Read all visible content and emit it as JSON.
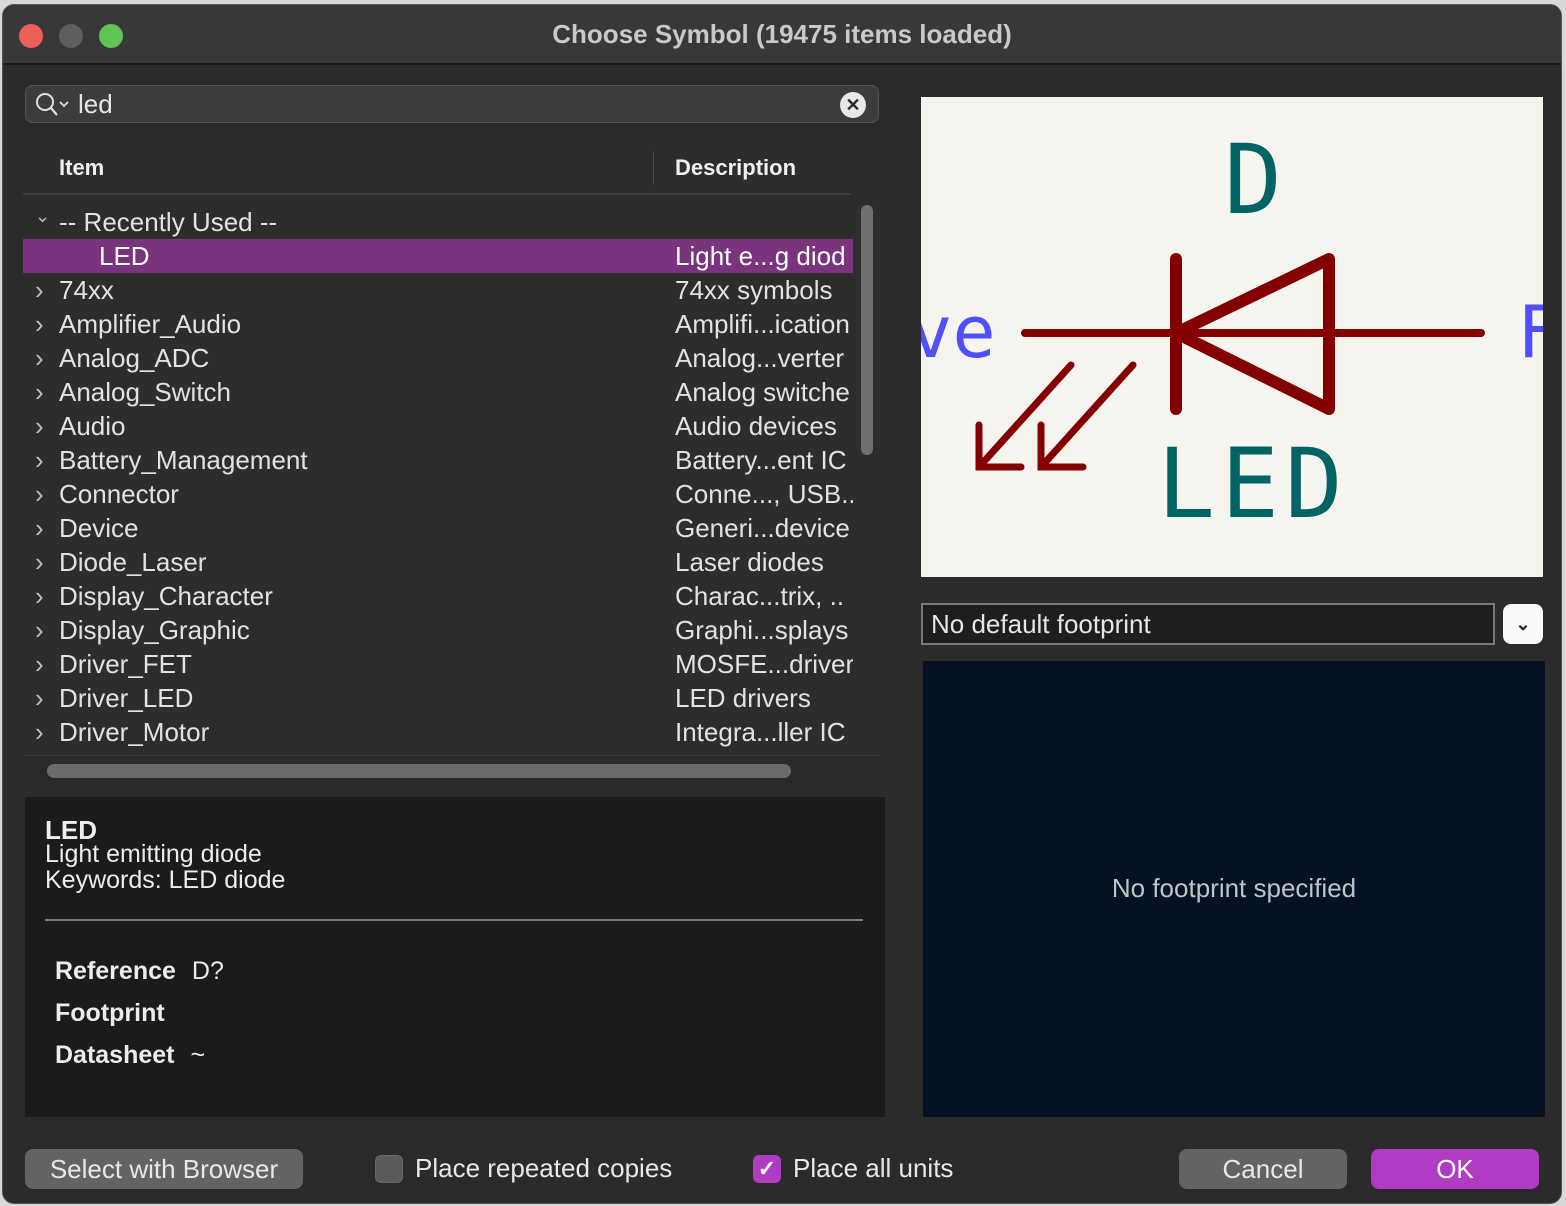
{
  "window": {
    "title": "Choose Symbol (19475 items loaded)"
  },
  "search": {
    "value": "led",
    "placeholder": "",
    "clear_icon": "✕"
  },
  "tree": {
    "columns": {
      "item": "Item",
      "description": "Description"
    },
    "rows": [
      {
        "name": "-- Recently Used --",
        "desc": "",
        "expanded": true,
        "child": false,
        "selected": false
      },
      {
        "name": "LED",
        "desc": "Light e...g diod",
        "child": true,
        "selected": true
      },
      {
        "name": "74xx",
        "desc": "74xx symbols",
        "child": false,
        "selected": false
      },
      {
        "name": "Amplifier_Audio",
        "desc": "Amplifi...ication",
        "child": false,
        "selected": false
      },
      {
        "name": "Analog_ADC",
        "desc": "Analog...verter",
        "child": false,
        "selected": false
      },
      {
        "name": "Analog_Switch",
        "desc": "Analog switche",
        "child": false,
        "selected": false
      },
      {
        "name": "Audio",
        "desc": "Audio devices",
        "child": false,
        "selected": false
      },
      {
        "name": "Battery_Management",
        "desc": "Battery...ent IC",
        "child": false,
        "selected": false
      },
      {
        "name": "Connector",
        "desc": "Conne..., USB..",
        "child": false,
        "selected": false
      },
      {
        "name": "Device",
        "desc": "Generi...device",
        "child": false,
        "selected": false
      },
      {
        "name": "Diode_Laser",
        "desc": "Laser diodes",
        "child": false,
        "selected": false
      },
      {
        "name": "Display_Character",
        "desc": "Charac...trix, ..",
        "child": false,
        "selected": false
      },
      {
        "name": "Display_Graphic",
        "desc": "Graphi...splays",
        "child": false,
        "selected": false
      },
      {
        "name": "Driver_FET",
        "desc": "MOSFE...driver",
        "child": false,
        "selected": false
      },
      {
        "name": "Driver_LED",
        "desc": "LED drivers",
        "child": false,
        "selected": false
      },
      {
        "name": "Driver_Motor",
        "desc": "Integra...ller IC",
        "child": false,
        "selected": false
      }
    ]
  },
  "info": {
    "name": "LED",
    "description": "Light emitting diode",
    "keywords": "Keywords: LED diode",
    "properties": [
      {
        "label": "Reference",
        "value": "D?"
      },
      {
        "label": "Footprint",
        "value": ""
      },
      {
        "label": "Datasheet",
        "value": "~"
      }
    ]
  },
  "preview": {
    "reference_text": "D",
    "value_text": "LED",
    "left_pin_text": "ve",
    "right_pin_text": "F",
    "colors": {
      "body": "#840000",
      "field": "#006464",
      "pin_name": "#4f4fff",
      "background": "#f5f4ef"
    }
  },
  "footprint": {
    "selected": "No default footprint",
    "message": "No footprint specified"
  },
  "footer": {
    "select_browser": "Select with Browser",
    "place_repeated_copies": {
      "label": "Place repeated copies",
      "checked": false
    },
    "place_all_units": {
      "label": "Place all units",
      "checked": true
    },
    "cancel": "Cancel",
    "ok": "OK",
    "check_glyph": "✓"
  },
  "colors": {
    "accent": "#b13cc4",
    "selection": "#7a347e"
  }
}
